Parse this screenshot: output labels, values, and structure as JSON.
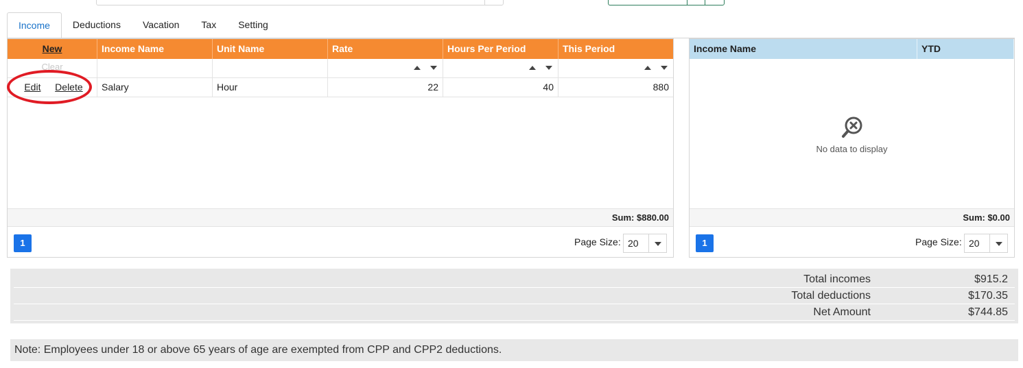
{
  "tabs": [
    "Income",
    "Deductions",
    "Vacation",
    "Tax",
    "Setting"
  ],
  "active_tab": "Income",
  "income_grid": {
    "new_label": "New",
    "columns": [
      "Income Name",
      "Unit Name",
      "Rate",
      "Hours Per Period",
      "This Period"
    ],
    "filter_clear": "Clear",
    "rows": [
      {
        "edit": "Edit",
        "delete": "Delete",
        "income_name": "Salary",
        "unit_name": "Hour",
        "rate": "22",
        "hours": "40",
        "this_period": "880"
      }
    ],
    "sum": "Sum: $880.00",
    "page": "1",
    "page_size_label": "Page Size:",
    "page_size": "20"
  },
  "ytd_grid": {
    "columns": [
      "Income Name",
      "YTD"
    ],
    "empty_text": "No data to display",
    "sum": "Sum: $0.00",
    "page": "1",
    "page_size_label": "Page Size:",
    "page_size": "20"
  },
  "totals": [
    {
      "label": "Total incomes",
      "value": "$915.2"
    },
    {
      "label": "Total deductions",
      "value": "$170.35"
    },
    {
      "label": "Net Amount",
      "value": "$744.85"
    }
  ],
  "note": "Note: Employees under 18 or above 65 years of age are exempted from CPP and CPP2 deductions.",
  "colors": {
    "income_header": "#f58a31",
    "ytd_header": "#bcdcef",
    "active_tab": "#1a73c9",
    "annotation": "#e01b24",
    "pager": "#1a73e8"
  }
}
